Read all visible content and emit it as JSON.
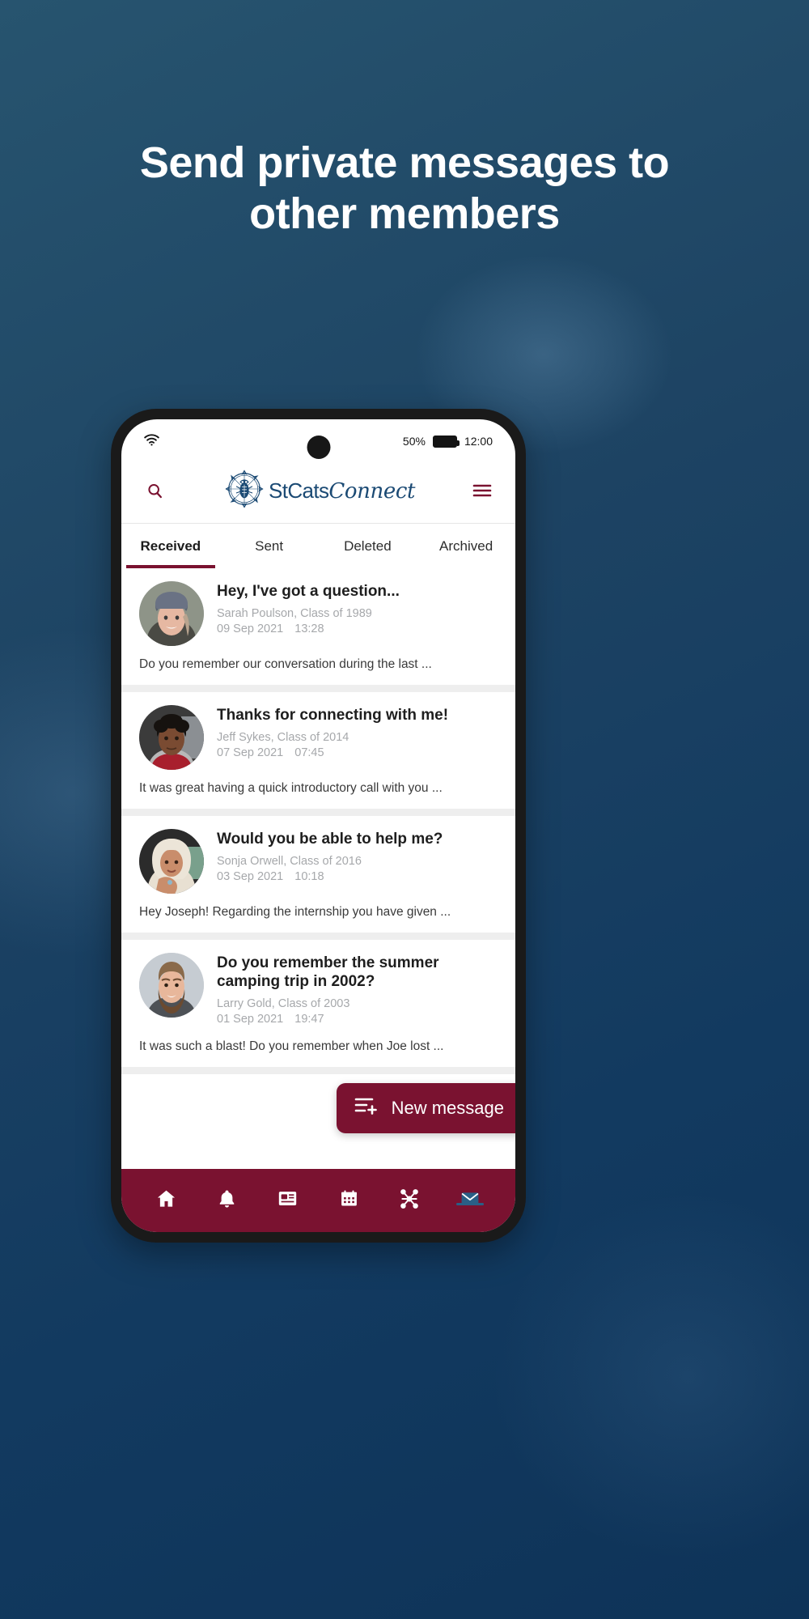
{
  "promo": {
    "headline": "Send private messages to other members",
    "background_color": "#1b4060"
  },
  "phone": {
    "status_bar": {
      "wifi_icon": "wifi-icon",
      "battery_percent": "50%",
      "battery_icon": "battery-icon",
      "time": "12:00"
    },
    "app_header": {
      "search_icon": "search-icon",
      "logo_crest_icon": "owl-crest-logo-icon",
      "logo_text_primary": "StCats",
      "logo_text_secondary": "Connect",
      "menu_icon": "hamburger-menu-icon",
      "brand_color": "#1b4a74",
      "accent_color": "#7a1230"
    },
    "tabs": [
      {
        "label": "Received",
        "active": true
      },
      {
        "label": "Sent",
        "active": false
      },
      {
        "label": "Deleted",
        "active": false
      },
      {
        "label": "Archived",
        "active": false
      }
    ],
    "messages": [
      {
        "subject": "Hey, I've got a question...",
        "sender": "Sarah Poulson, Class of 1989",
        "date": "09 Sep 2021",
        "time": "13:28",
        "preview": "Do you remember our conversation during the last ...",
        "avatar": "woman-in-grey-beanie-avatar"
      },
      {
        "subject": "Thanks for connecting with me!",
        "sender": "Jeff Sykes, Class of 2014",
        "date": "07 Sep 2021",
        "time": "07:45",
        "preview": "It was great having a quick introductory call with you ...",
        "avatar": "young-man-curly-hair-avatar"
      },
      {
        "subject": "Would you be able to help me?",
        "sender": "Sonja Orwell, Class of 2016",
        "date": "03 Sep 2021",
        "time": "10:18",
        "preview": "Hey Joseph! Regarding the internship you have given ...",
        "avatar": "woman-in-headscarf-avatar"
      },
      {
        "subject": "Do you remember the summer camping trip in 2002?",
        "sender": "Larry Gold, Class of 2003",
        "date": "01 Sep 2021",
        "time": "19:47",
        "preview": "It was such a blast! Do you remember when  Joe lost ...",
        "avatar": "bearded-man-avatar"
      }
    ],
    "new_message_button": {
      "label": "New message",
      "icon": "new-message-icon"
    },
    "bottom_nav": [
      {
        "icon": "home-icon",
        "active": false
      },
      {
        "icon": "bell-icon",
        "active": false
      },
      {
        "icon": "news-icon",
        "active": false
      },
      {
        "icon": "calendar-icon",
        "active": false
      },
      {
        "icon": "network-icon",
        "active": false
      },
      {
        "icon": "messages-icon",
        "active": true
      }
    ]
  }
}
